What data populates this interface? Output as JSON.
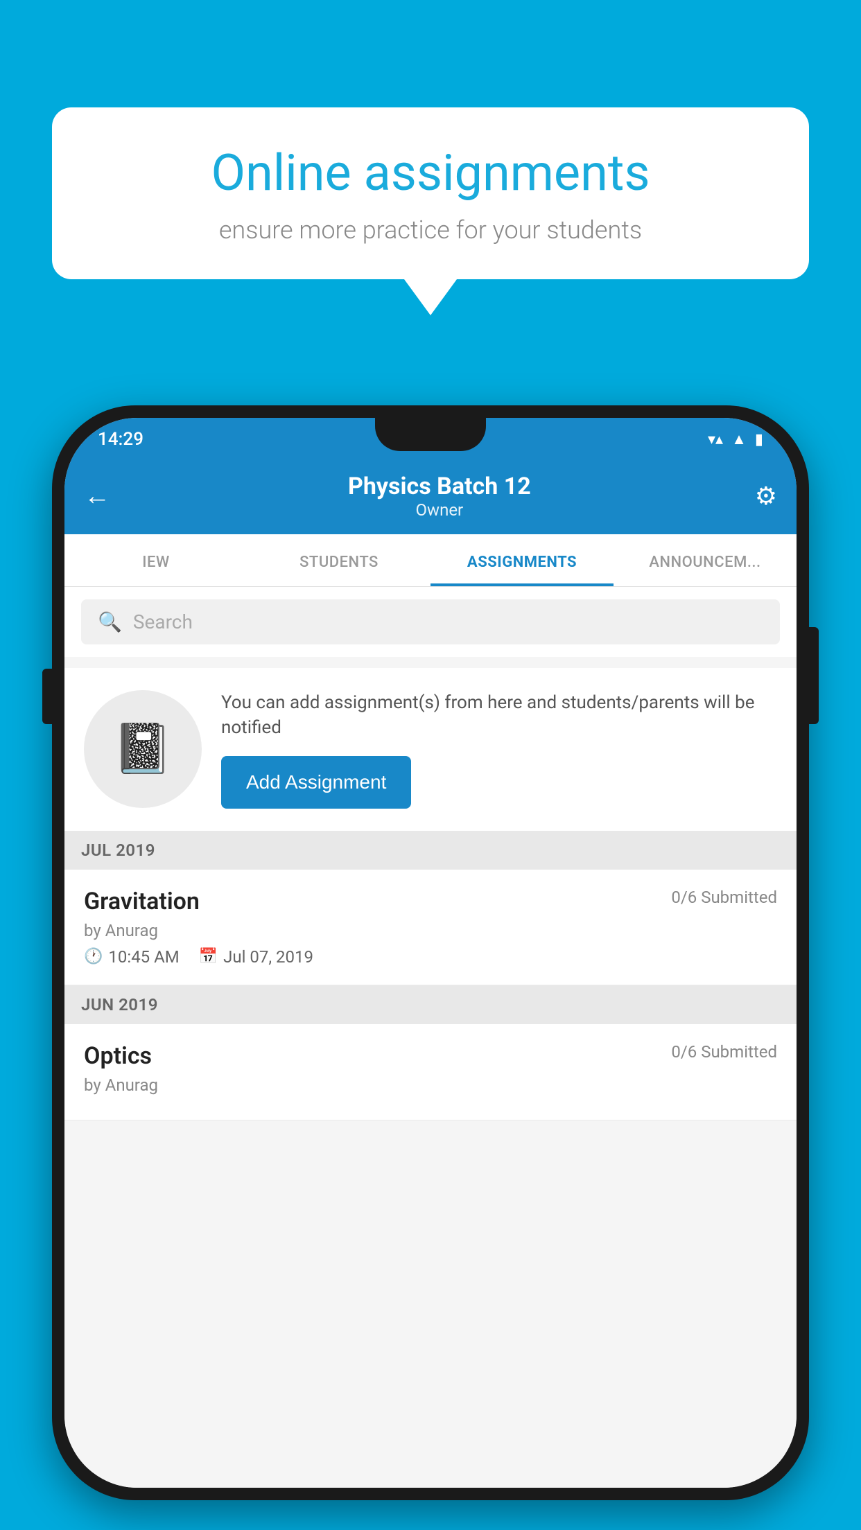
{
  "background_color": "#00AADC",
  "speech_bubble": {
    "title": "Online assignments",
    "subtitle": "ensure more practice for your students"
  },
  "status_bar": {
    "time": "14:29",
    "wifi": "▼",
    "signal": "▲",
    "battery": "▮"
  },
  "app_bar": {
    "title": "Physics Batch 12",
    "subtitle": "Owner",
    "back_icon": "←",
    "settings_icon": "⚙"
  },
  "tabs": [
    {
      "label": "IEW",
      "active": false
    },
    {
      "label": "STUDENTS",
      "active": false
    },
    {
      "label": "ASSIGNMENTS",
      "active": true
    },
    {
      "label": "ANNOUNCEM...",
      "active": false
    }
  ],
  "search": {
    "placeholder": "Search"
  },
  "promo": {
    "description": "You can add assignment(s) from here and students/parents will be notified",
    "button_label": "Add Assignment"
  },
  "sections": [
    {
      "header": "JUL 2019",
      "assignments": [
        {
          "title": "Gravitation",
          "submitted": "0/6 Submitted",
          "by": "by Anurag",
          "time": "10:45 AM",
          "date": "Jul 07, 2019"
        }
      ]
    },
    {
      "header": "JUN 2019",
      "assignments": [
        {
          "title": "Optics",
          "submitted": "0/6 Submitted",
          "by": "by Anurag",
          "time": "",
          "date": ""
        }
      ]
    }
  ]
}
